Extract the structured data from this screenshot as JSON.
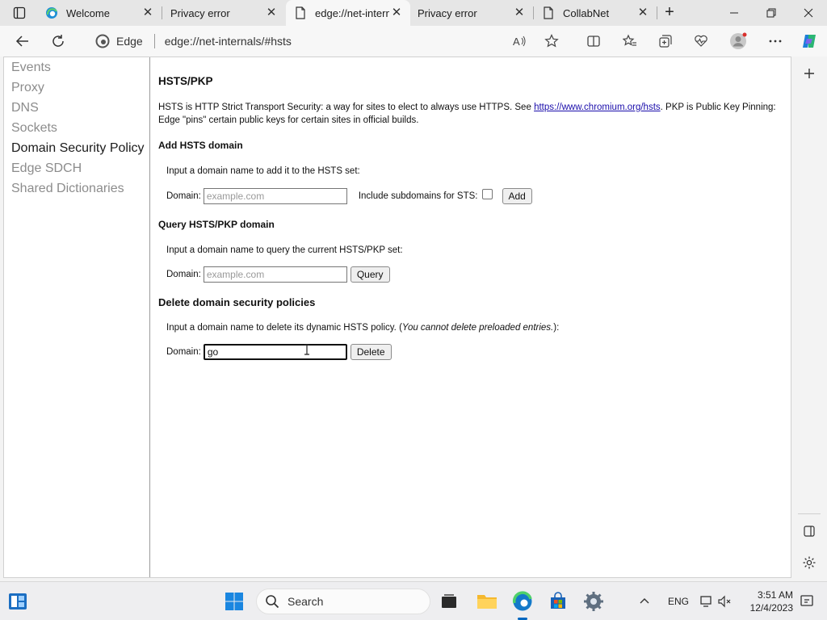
{
  "browser": {
    "tabs": [
      {
        "title": "Welcome",
        "icon": "edge-logo-icon",
        "active": false
      },
      {
        "title": "Privacy error",
        "icon": "none",
        "active": false
      },
      {
        "title": "edge://net-internals/#hsts",
        "icon": "page-icon",
        "active": true
      },
      {
        "title": "Privacy error",
        "icon": "none",
        "active": false
      },
      {
        "title": "CollabNet",
        "icon": "page-icon",
        "active": false
      }
    ],
    "site_chip": "Edge",
    "url": "edge://net-internals/#hsts"
  },
  "nav": {
    "items": [
      {
        "label": "Events",
        "selected": false
      },
      {
        "label": "Proxy",
        "selected": false
      },
      {
        "label": "DNS",
        "selected": false
      },
      {
        "label": "Sockets",
        "selected": false
      },
      {
        "label": "Domain Security Policy",
        "selected": true
      },
      {
        "label": "Edge SDCH",
        "selected": false
      },
      {
        "label": "Shared Dictionaries",
        "selected": false
      }
    ]
  },
  "hsts": {
    "title": "HSTS/PKP",
    "desc_part1": "HSTS is HTTP Strict Transport Security: a way for sites to elect to always use HTTPS. See ",
    "desc_link": "https://www.chromium.org/hsts",
    "desc_part2": ". PKP is Public Key Pinning: Edge \"pins\" certain public keys for certain sites in official builds.",
    "add": {
      "heading": "Add HSTS domain",
      "instruction": "Input a domain name to add it to the HSTS set:",
      "domain_label": "Domain:",
      "placeholder": "example.com",
      "include_label": "Include subdomains for STS:",
      "button": "Add"
    },
    "query": {
      "heading": "Query HSTS/PKP domain",
      "instruction": "Input a domain name to query the current HSTS/PKP set:",
      "domain_label": "Domain:",
      "placeholder": "example.com",
      "button": "Query"
    },
    "delete": {
      "heading": "Delete domain security policies",
      "instruction_main": "Input a domain name to delete its dynamic HSTS policy. (",
      "instruction_italic": "You cannot delete preloaded entries.",
      "instruction_end": "):",
      "domain_label": "Domain:",
      "value": "go",
      "button": "Delete"
    }
  },
  "taskbar": {
    "search_label": "Search",
    "language": "ENG",
    "time": "3:51 AM",
    "date": "12/4/2023"
  },
  "colors": {
    "accent": "#0067c0",
    "link": "#1a0dab",
    "nav_inactive": "#8c8c8c"
  }
}
